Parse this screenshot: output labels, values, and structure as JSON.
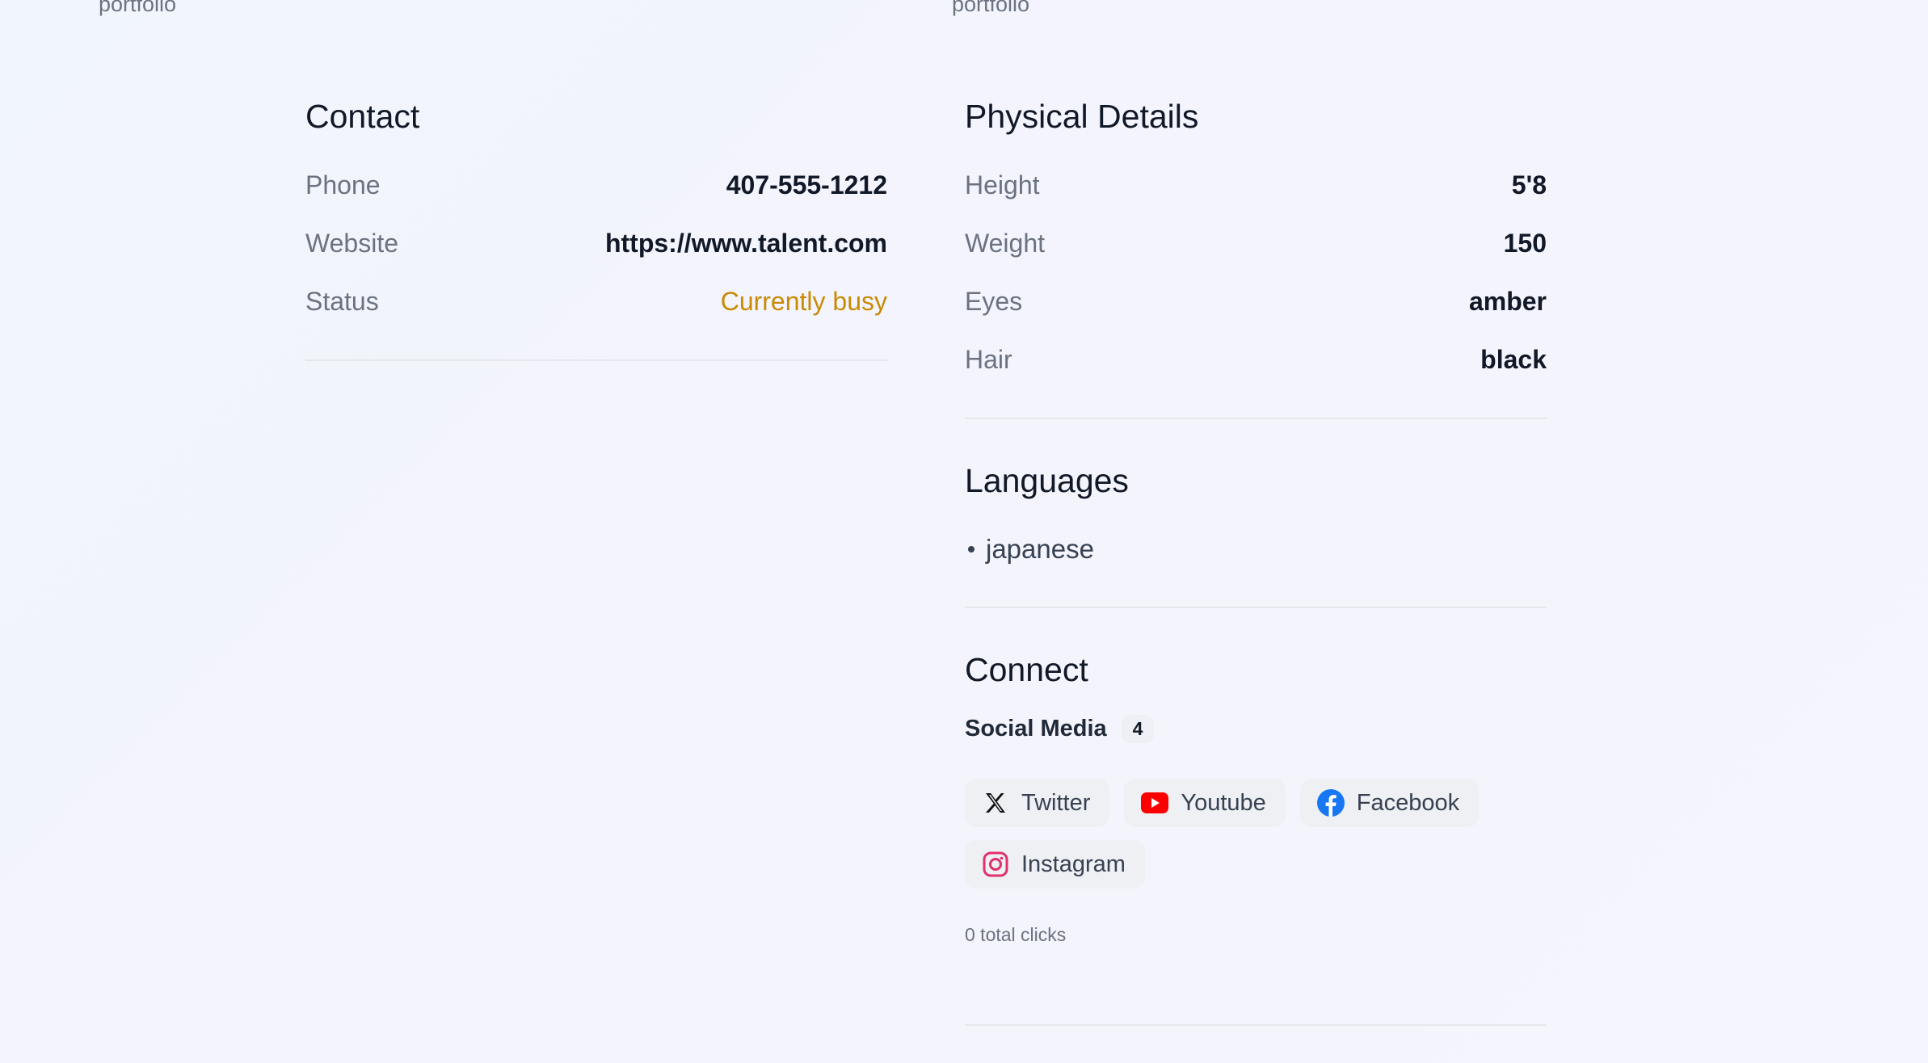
{
  "top": {
    "left_label": "portfolio",
    "right_label": "portfolio"
  },
  "contact": {
    "title": "Contact",
    "rows": [
      {
        "label": "Phone",
        "value": "407-555-1212"
      },
      {
        "label": "Website",
        "value": "https://www.talent.com"
      },
      {
        "label": "Status",
        "value": "Currently busy"
      }
    ],
    "status_color": "#ca8a04"
  },
  "physical": {
    "title": "Physical Details",
    "rows": [
      {
        "label": "Height",
        "value": "5'8"
      },
      {
        "label": "Weight",
        "value": "150"
      },
      {
        "label": "Eyes",
        "value": "amber"
      },
      {
        "label": "Hair",
        "value": "black"
      }
    ]
  },
  "languages": {
    "title": "Languages",
    "items": [
      "japanese"
    ]
  },
  "connect": {
    "title": "Connect",
    "social_label": "Social Media",
    "social_count": "4",
    "links": [
      {
        "label": "Twitter",
        "icon": "x-twitter-icon"
      },
      {
        "label": "Youtube",
        "icon": "youtube-icon"
      },
      {
        "label": "Facebook",
        "icon": "facebook-icon"
      },
      {
        "label": "Instagram",
        "icon": "instagram-icon"
      }
    ],
    "clicks": "0 total clicks"
  },
  "colors": {
    "youtube": "#ff0000",
    "facebook": "#1877f2",
    "instagram": "#e1306c"
  }
}
